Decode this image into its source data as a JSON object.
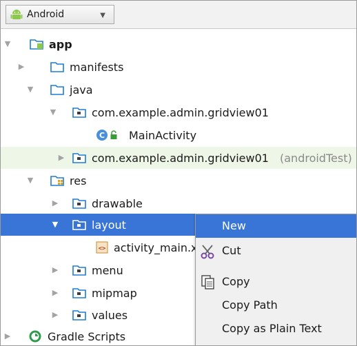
{
  "project_view": {
    "selector_label": "Android",
    "tree": [
      {
        "label": "app",
        "state": "expanded",
        "icon": "app-module-icon"
      },
      {
        "label": "manifests",
        "state": "collapsed",
        "icon": "folder-icon"
      },
      {
        "label": "java",
        "state": "expanded",
        "icon": "folder-icon"
      },
      {
        "label": "com.example.admin.gridview01",
        "state": "expanded",
        "icon": "package-icon"
      },
      {
        "label": "MainActivity",
        "state": "leaf",
        "icon": "class-icon"
      },
      {
        "label": "com.example.admin.gridview01",
        "suffix": "(androidTest)",
        "state": "collapsed",
        "icon": "package-icon"
      },
      {
        "label": "res",
        "state": "expanded",
        "icon": "res-folder-icon"
      },
      {
        "label": "drawable",
        "state": "collapsed",
        "icon": "package-icon"
      },
      {
        "label": "layout",
        "state": "expanded",
        "icon": "package-icon",
        "selected": true
      },
      {
        "label": "activity_main.xml",
        "state": "leaf",
        "icon": "xml-file-icon"
      },
      {
        "label": "menu",
        "state": "collapsed",
        "icon": "package-icon"
      },
      {
        "label": "mipmap",
        "state": "collapsed",
        "icon": "package-icon"
      },
      {
        "label": "values",
        "state": "collapsed",
        "icon": "package-icon"
      },
      {
        "label": "Gradle Scripts",
        "state": "collapsed",
        "icon": "gradle-icon"
      }
    ]
  },
  "context_menu": {
    "items": [
      {
        "label": "New",
        "active": true
      },
      {
        "label": "Cut",
        "icon": "scissors-icon"
      },
      {
        "label": "Copy",
        "icon": "copy-icon"
      },
      {
        "label": "Copy Path"
      },
      {
        "label": "Copy as Plain Text"
      }
    ]
  },
  "colors": {
    "selection": "#3875d7",
    "test_row": "#eef6e8",
    "folder_blue": "#1f7bd6",
    "android_green": "#8cc84b"
  }
}
